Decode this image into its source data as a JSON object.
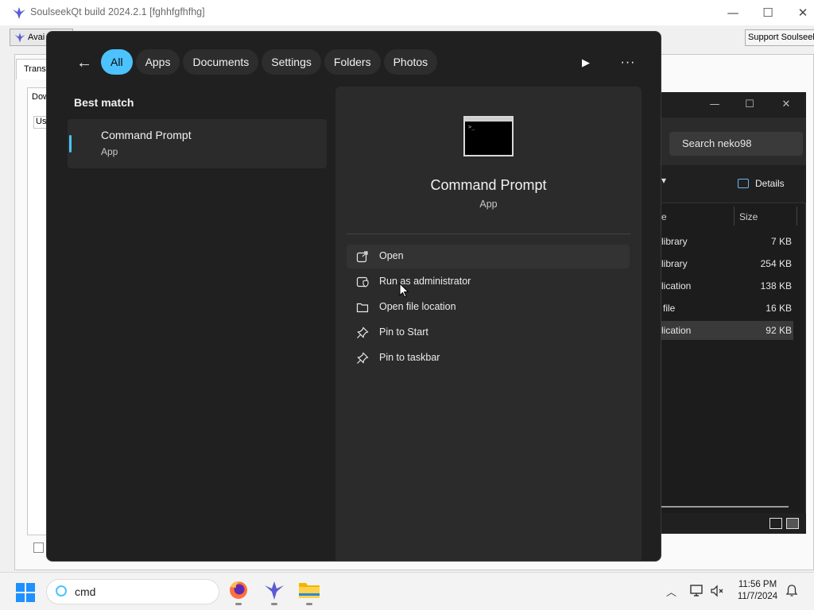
{
  "soulseek": {
    "title": "SoulseekQt build 2024.2.1 [fghhfgfhfhg]",
    "toolbar_button": "Avai",
    "support_button": "Support Soulseek",
    "tab": "Transf",
    "inner_tab": "Dow",
    "inner_col": "Us",
    "controls": [
      "—",
      "☐",
      "✕"
    ]
  },
  "explorer": {
    "controls": [
      "—",
      "☐",
      "✕"
    ],
    "search_placeholder": "Search neko98",
    "details_label": "Details",
    "header": {
      "name": "e",
      "size": "Size"
    },
    "rows": [
      {
        "name": "library",
        "size": "7 KB"
      },
      {
        "name": "library",
        "size": "254 KB"
      },
      {
        "name": "lication",
        "size": "138 KB"
      },
      {
        "name": "file",
        "size": "16 KB"
      },
      {
        "name": "lication",
        "size": "92 KB"
      }
    ]
  },
  "search_panel": {
    "filters": [
      "All",
      "Apps",
      "Documents",
      "Settings",
      "Folders",
      "Photos"
    ],
    "active_filter": "All",
    "best_match_label": "Best match",
    "result": {
      "title": "Command Prompt",
      "subtitle": "App"
    },
    "detail": {
      "title": "Command Prompt",
      "subtitle": "App",
      "actions": [
        {
          "label": "Open",
          "icon": "open-external-icon"
        },
        {
          "label": "Run as administrator",
          "icon": "shield-admin-icon"
        },
        {
          "label": "Open file location",
          "icon": "folder-icon"
        },
        {
          "label": "Pin to Start",
          "icon": "pin-icon"
        },
        {
          "label": "Pin to taskbar",
          "icon": "pin-icon"
        }
      ]
    }
  },
  "taskbar": {
    "search_text": "cmd",
    "apps": [
      "firefox-icon",
      "soulseek-icon",
      "file-explorer-icon"
    ],
    "clock_time": "11:56 PM",
    "clock_date": "11/7/2024"
  },
  "colors": {
    "accent": "#4cc2ff",
    "panel_bg": "#202020",
    "detail_bg": "#2b2b2b"
  }
}
